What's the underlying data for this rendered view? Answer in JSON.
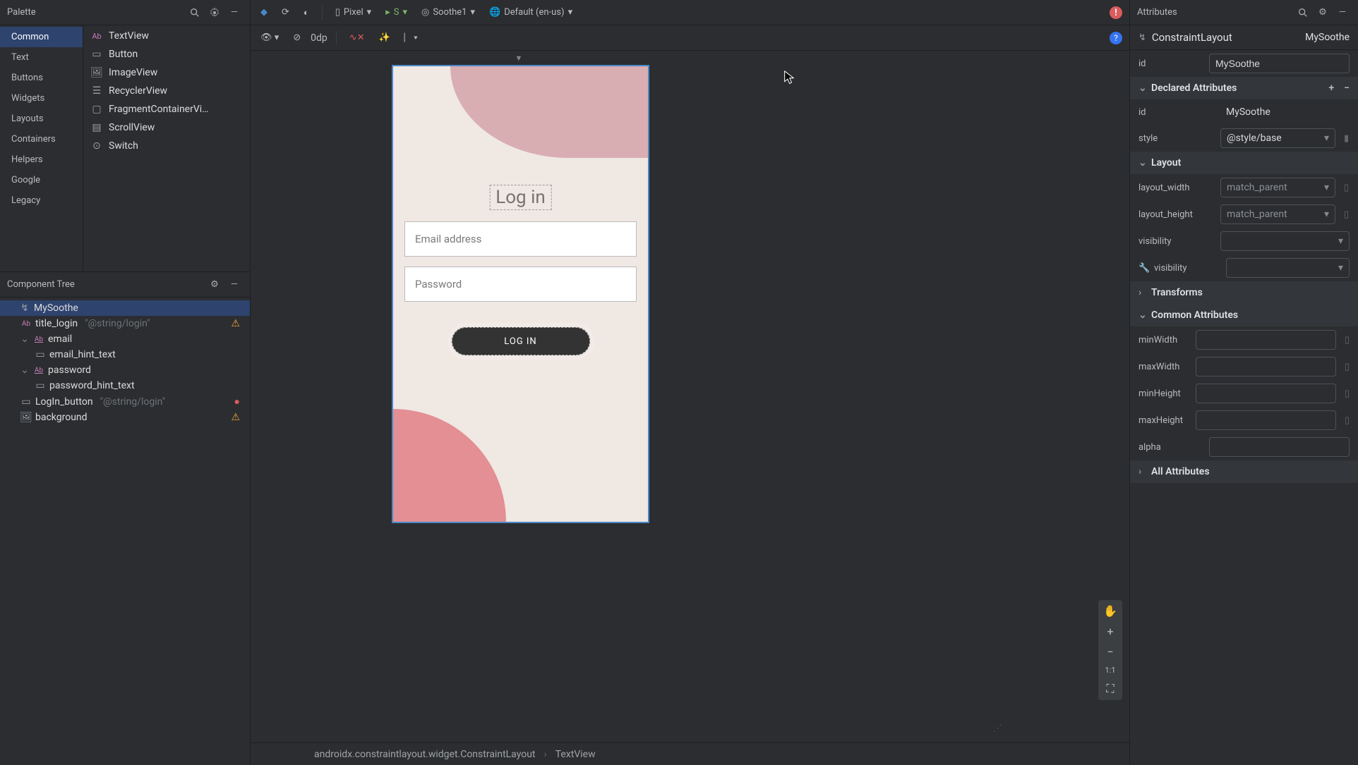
{
  "palette": {
    "title": "Palette",
    "categories": [
      "Common",
      "Text",
      "Buttons",
      "Widgets",
      "Layouts",
      "Containers",
      "Helpers",
      "Google",
      "Legacy"
    ],
    "items": [
      {
        "icon": "Ab",
        "label": "TextView"
      },
      {
        "icon": "button",
        "label": "Button"
      },
      {
        "icon": "image",
        "label": "ImageView"
      },
      {
        "icon": "list",
        "label": "RecyclerView"
      },
      {
        "icon": "frag",
        "label": "FragmentContainerVi…"
      },
      {
        "icon": "scroll",
        "label": "ScrollView"
      },
      {
        "icon": "switch",
        "label": "Switch"
      }
    ]
  },
  "tree": {
    "title": "Component Tree",
    "rows": [
      {
        "depth": 0,
        "icon": "cl",
        "name": "MySoothe",
        "selected": true
      },
      {
        "depth": 1,
        "icon": "Ab",
        "name": "title_login",
        "sub": "\"@string/login\"",
        "warn": "⚠"
      },
      {
        "depth": 1,
        "icon": "Ab",
        "name": "email",
        "chev": true
      },
      {
        "depth": 2,
        "icon": "rect",
        "name": "email_hint_text"
      },
      {
        "depth": 1,
        "icon": "Ab",
        "name": "password",
        "chev": true
      },
      {
        "depth": 2,
        "icon": "rect",
        "name": "password_hint_text"
      },
      {
        "depth": 1,
        "icon": "rect",
        "name": "LogIn_button",
        "sub": "\"@string/login\"",
        "warn": "●"
      },
      {
        "depth": 1,
        "icon": "image",
        "name": "background",
        "warn": "⚠"
      }
    ]
  },
  "toolbar": {
    "device": "Pixel",
    "api": "S",
    "theme": "Soothe1",
    "locale": "Default (en-us)",
    "dp": "0dp"
  },
  "preview": {
    "title": "Log in",
    "email_hint": "Email address",
    "password_hint": "Password",
    "button": "LOG IN"
  },
  "breadcrumb": {
    "a": "androidx.constraintlayout.widget.ConstraintLayout",
    "b": "TextView"
  },
  "attributes": {
    "title": "Attributes",
    "type": "ConstraintLayout",
    "type_id": "MySoothe",
    "id_label": "id",
    "id_value": "MySoothe",
    "sections": {
      "declared": "Declared Attributes",
      "layout": "Layout",
      "transforms": "Transforms",
      "common": "Common Attributes",
      "all": "All Attributes"
    },
    "declared": {
      "id_label": "id",
      "id_value": "MySoothe",
      "style_label": "style",
      "style_value": "@style/base"
    },
    "layout": {
      "lw_label": "layout_width",
      "lw_value": "match_parent",
      "lh_label": "layout_height",
      "lh_value": "match_parent",
      "vis_label": "visibility",
      "tvis_label": "visibility"
    },
    "common": {
      "minW": "minWidth",
      "maxW": "maxWidth",
      "minH": "minHeight",
      "maxH": "maxHeight",
      "alpha": "alpha"
    }
  },
  "zoom": {
    "hand": "✋",
    "plus": "+",
    "minus": "−",
    "one": "1:1",
    "fit": "⛶"
  }
}
